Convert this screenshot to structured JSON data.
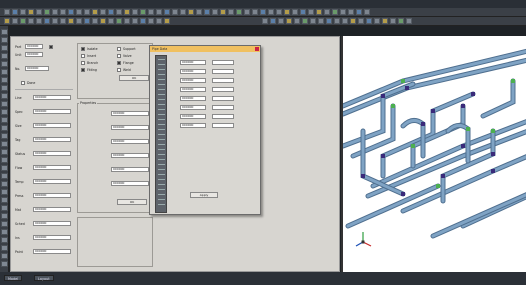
{
  "window": {
    "title": "",
    "center_title": ""
  },
  "toolbar_icons": [
    "open-icon",
    "save-icon",
    "print-icon",
    "undo-icon",
    "redo-icon",
    "cut-icon",
    "copy-icon",
    "paste-icon",
    "zoom-icon",
    "pan-icon",
    "rotate-icon",
    "measure-icon"
  ],
  "left_form": {
    "field_a_label": "Part",
    "field_b_label": "Unit",
    "field_c_label": "No.",
    "check_label": "Done",
    "field_value": "000000",
    "list_labels": [
      "Line",
      "Spec",
      "Size",
      "Tag",
      "Status",
      "Flow",
      "Temp",
      "Press",
      "Mat",
      "Sched",
      "Ins",
      "Paint"
    ],
    "list_values": [
      "000000",
      "000000",
      "000000",
      "000000",
      "000000",
      "000000",
      "000000",
      "000000",
      "000000",
      "000000",
      "000000",
      "000000"
    ]
  },
  "options_panel": {
    "items": [
      "Isolate",
      "Insert",
      "Branch",
      "Fitting",
      "Support",
      "Valve",
      "Flange",
      "Weld"
    ]
  },
  "mid_form": {
    "rows": [
      "000000",
      "000000",
      "000000",
      "000000",
      "000000",
      "000000"
    ],
    "section_label": "Properties",
    "button_label": "OK"
  },
  "dialog": {
    "title": "Pipe Data",
    "rows": [
      "000000",
      "000000",
      "000000",
      "000000",
      "000000",
      "000000",
      "000000",
      "000000"
    ],
    "ok_label": "Apply"
  },
  "status": {
    "tabs": [
      "Model",
      "Layout"
    ]
  },
  "colors": {
    "pipe": "#7fa3c4",
    "node": "#3a2a7a",
    "joint": "#4caf50"
  }
}
